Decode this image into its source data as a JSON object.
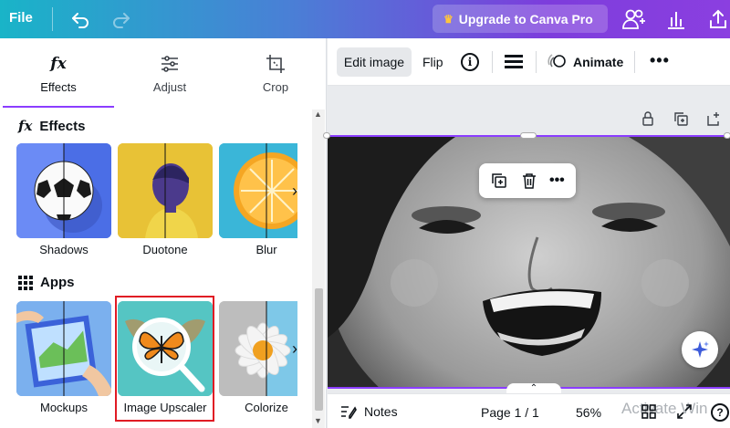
{
  "topbar": {
    "file_label": "File",
    "upgrade_label": "Upgrade to Canva Pro",
    "icons": [
      "undo-icon",
      "redo-icon",
      "crown-icon",
      "share-people-icon",
      "bar-chart-icon",
      "upload-icon"
    ]
  },
  "side_panel": {
    "tabs": [
      {
        "label": "Effects",
        "icon": "fx-icon",
        "active": true
      },
      {
        "label": "Adjust",
        "icon": "sliders-icon",
        "active": false
      },
      {
        "label": "Crop",
        "icon": "crop-icon",
        "active": false
      }
    ],
    "effects_section": {
      "title": "Effects",
      "items": [
        {
          "label": "Shadows"
        },
        {
          "label": "Duotone"
        },
        {
          "label": "Blur"
        }
      ]
    },
    "apps_section": {
      "title": "Apps",
      "items": [
        {
          "label": "Mockups"
        },
        {
          "label": "Image Upscaler",
          "highlighted": true
        },
        {
          "label": "Colorize"
        }
      ]
    }
  },
  "toolbar": {
    "edit_image_label": "Edit image",
    "flip_label": "Flip",
    "info_glyph": "i",
    "animate_label": "Animate",
    "more_glyph": "•••"
  },
  "canvas": {
    "context_more_glyph": "•••",
    "collapse_glyph": "⌃"
  },
  "bottombar": {
    "notes_label": "Notes",
    "page_label": "Page 1 / 1",
    "zoom_label": "56%",
    "watermark_text": "Activate Win",
    "help_glyph": "?"
  },
  "colors": {
    "accent": "#8b3dff",
    "highlight_box": "#e01b24",
    "gradient_start": "#19b4c8",
    "gradient_end": "#8b3fe0"
  }
}
